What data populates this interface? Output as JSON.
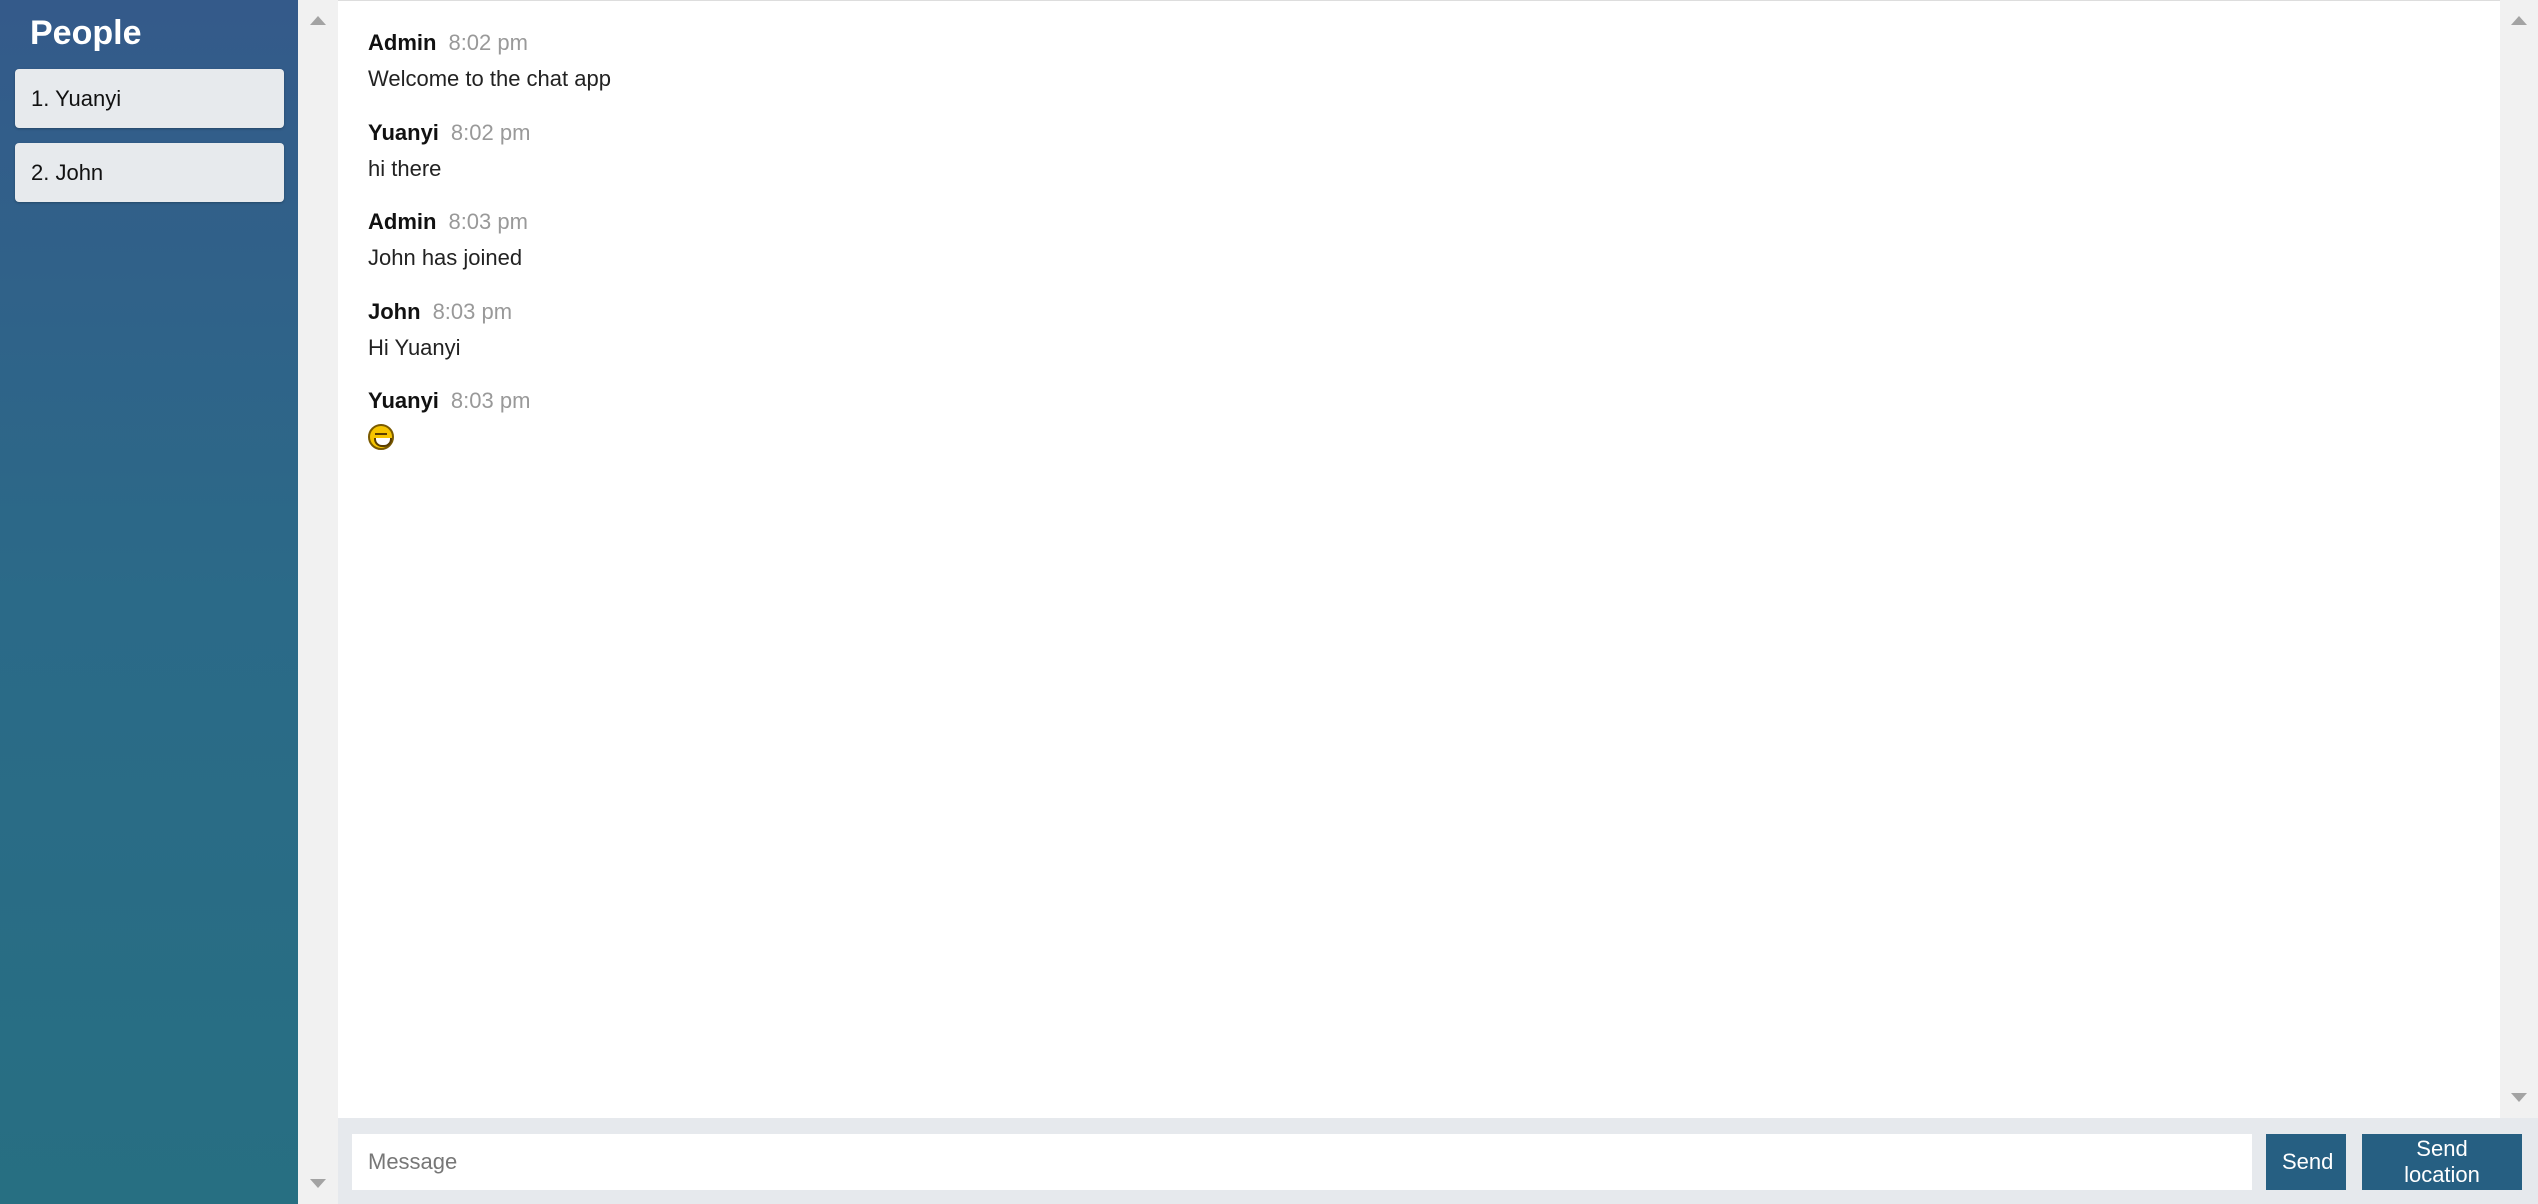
{
  "sidebar": {
    "title": "People",
    "users": [
      "1. Yuanyi",
      "2. John"
    ]
  },
  "messages": [
    {
      "name": "Admin",
      "time": "8:02 pm",
      "text": "Welcome to the chat app"
    },
    {
      "name": "Yuanyi",
      "time": "8:02 pm",
      "text": "hi there"
    },
    {
      "name": "Admin",
      "time": "8:03 pm",
      "text": "John has joined"
    },
    {
      "name": "John",
      "time": "8:03 pm",
      "text": "Hi Yuanyi"
    },
    {
      "name": "Yuanyi",
      "time": "8:03 pm",
      "emoji": "grinning-face-icon"
    }
  ],
  "composer": {
    "placeholder": "Message",
    "send_label": "Send",
    "send_location_label": "Send location"
  },
  "colors": {
    "sidebar_top": "#345a8a",
    "sidebar_bottom": "#276f82",
    "button": "#265f82",
    "timestamp": "#999999"
  }
}
